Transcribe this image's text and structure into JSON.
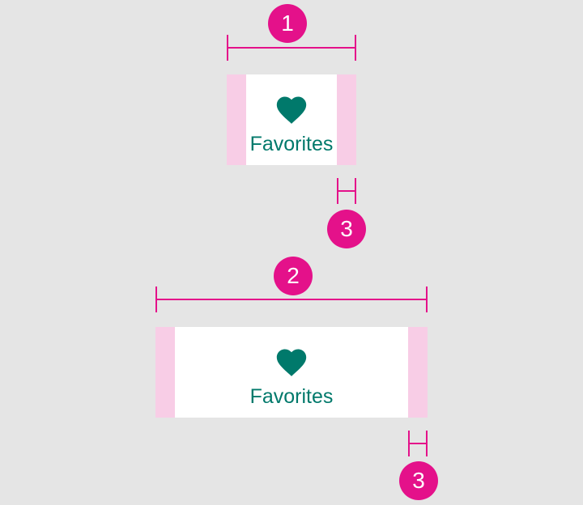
{
  "colors": {
    "background": "#e5e5e5",
    "annotation": "#e4118a",
    "padding": "#f8cde6",
    "tab_surface": "#ffffff",
    "active_content": "#00796b"
  },
  "annotations": {
    "min_width_marker": "1",
    "max_width_marker": "2",
    "padding_marker_top": "3",
    "padding_marker_bottom": "3"
  },
  "tab_narrow": {
    "label": "Favorites",
    "icon": "heart-icon"
  },
  "tab_wide": {
    "label": "Favorites",
    "icon": "heart-icon"
  }
}
